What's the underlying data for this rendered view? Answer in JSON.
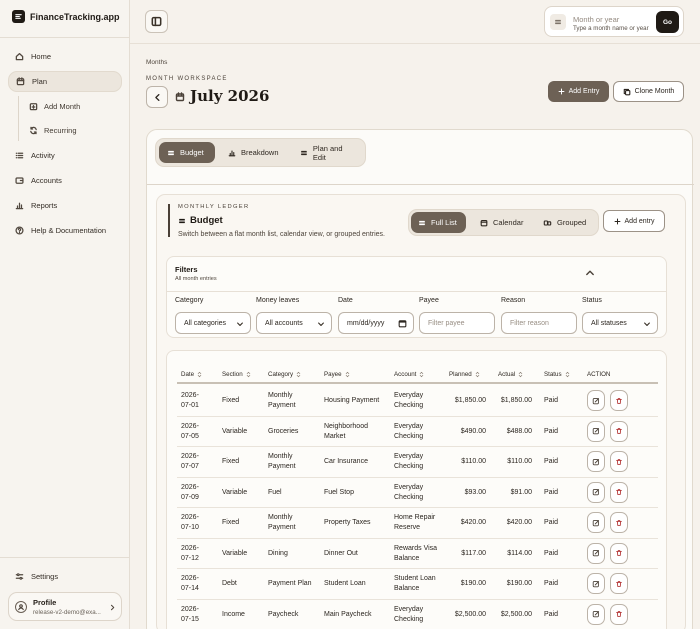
{
  "app": {
    "name": "FinanceTracking.app"
  },
  "sidebar": {
    "items": [
      {
        "label": "Home",
        "icon": "home-icon"
      },
      {
        "label": "Plan",
        "icon": "calendar-icon",
        "active": true
      },
      {
        "label": "Activity",
        "icon": "list-icon"
      },
      {
        "label": "Accounts",
        "icon": "wallet-icon"
      },
      {
        "label": "Reports",
        "icon": "bar-chart-icon"
      },
      {
        "label": "Help & Documentation",
        "icon": "help-circle-icon"
      }
    ],
    "plan_children": [
      {
        "label": "Add Month",
        "icon": "calendar-plus-icon"
      },
      {
        "label": "Recurring",
        "icon": "refresh-icon"
      }
    ],
    "settings_label": "Settings",
    "profile": {
      "name": "Profile",
      "email": "release-v2-demo@exa..."
    }
  },
  "topbar": {
    "month_search": {
      "placeholder": "Month or year",
      "hint": "Type a month name or year",
      "go_label": "Go"
    }
  },
  "header": {
    "breadcrumb": "Months",
    "workspace_label": "MONTH WORKSPACE",
    "title": "July 2026",
    "add_entry_label": "Add Entry",
    "clone_label": "Clone Month"
  },
  "tabs": [
    {
      "label": "Budget",
      "active": true
    },
    {
      "label": "Breakdown"
    },
    {
      "label": "Plan and Edit"
    }
  ],
  "ledger": {
    "kicker": "MONTHLY LEDGER",
    "title": "Budget",
    "description": "Switch between a flat month list, calendar view, or grouped entries.",
    "views": [
      {
        "label": "Full List",
        "active": true
      },
      {
        "label": "Calendar"
      },
      {
        "label": "Grouped"
      }
    ],
    "add_label": "Add entry"
  },
  "filters": {
    "title": "Filters",
    "subtitle": "All month entries",
    "fields": [
      {
        "label": "Category",
        "value": "All categories",
        "kind": "select"
      },
      {
        "label": "Money leaves",
        "value": "All accounts",
        "kind": "select"
      },
      {
        "label": "Date",
        "value": "mm/dd/yyyy",
        "kind": "date"
      },
      {
        "label": "Payee",
        "value": "Filter payee",
        "kind": "text"
      },
      {
        "label": "Reason",
        "value": "Filter reason",
        "kind": "text"
      },
      {
        "label": "Status",
        "value": "All statuses",
        "kind": "select"
      }
    ]
  },
  "table": {
    "columns": [
      "Date",
      "Section",
      "Category",
      "Payee",
      "Account",
      "Planned",
      "Actual",
      "Status",
      "ACTION"
    ],
    "rows": [
      {
        "date": "2026-\n07-01",
        "section": "Fixed",
        "category": "Monthly\nPayment",
        "payee": "Housing Payment",
        "account": "Everyday\nChecking",
        "planned": "$1,850.00",
        "actual": "$1,850.00",
        "status": "Paid"
      },
      {
        "date": "2026-\n07-05",
        "section": "Variable",
        "category": "Groceries",
        "payee": "Neighborhood\nMarket",
        "account": "Everyday\nChecking",
        "planned": "$490.00",
        "actual": "$488.00",
        "status": "Paid"
      },
      {
        "date": "2026-\n07-07",
        "section": "Fixed",
        "category": "Monthly\nPayment",
        "payee": "Car Insurance",
        "account": "Everyday\nChecking",
        "planned": "$110.00",
        "actual": "$110.00",
        "status": "Paid"
      },
      {
        "date": "2026-\n07-09",
        "section": "Variable",
        "category": "Fuel",
        "payee": "Fuel Stop",
        "account": "Everyday\nChecking",
        "planned": "$93.00",
        "actual": "$91.00",
        "status": "Paid"
      },
      {
        "date": "2026-\n07-10",
        "section": "Fixed",
        "category": "Monthly\nPayment",
        "payee": "Property Taxes",
        "account": "Home Repair\nReserve",
        "planned": "$420.00",
        "actual": "$420.00",
        "status": "Paid"
      },
      {
        "date": "2026-\n07-12",
        "section": "Variable",
        "category": "Dining",
        "payee": "Dinner Out",
        "account": "Rewards Visa\nBalance",
        "planned": "$117.00",
        "actual": "$114.00",
        "status": "Paid"
      },
      {
        "date": "2026-\n07-14",
        "section": "Debt",
        "category": "Payment Plan",
        "payee": "Student Loan",
        "account": "Student Loan\nBalance",
        "planned": "$190.00",
        "actual": "$190.00",
        "status": "Paid"
      },
      {
        "date": "2026-\n07-15",
        "section": "Income",
        "category": "Paycheck",
        "payee": "Main Paycheck",
        "account": "Everyday\nChecking",
        "planned": "$2,500.00",
        "actual": "$2,500.00",
        "status": "Paid"
      }
    ]
  }
}
